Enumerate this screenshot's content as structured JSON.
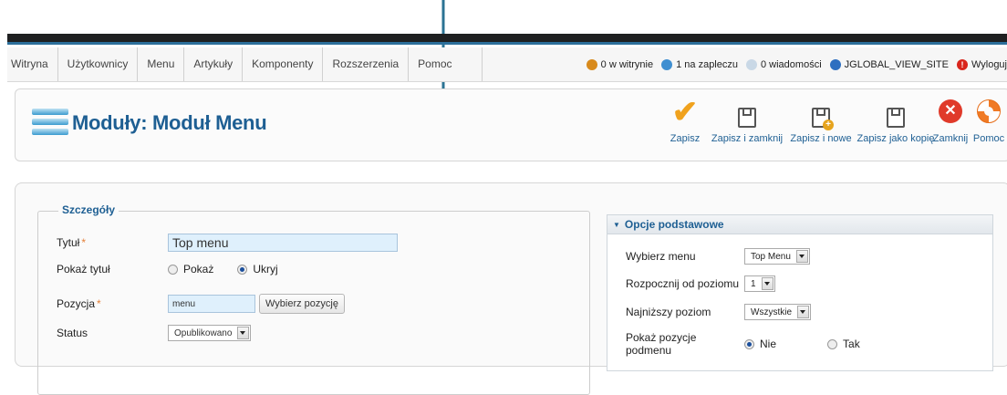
{
  "menubar": {
    "items": [
      "Witryna",
      "Użytkownicy",
      "Menu",
      "Artykuły",
      "Komponenty",
      "Rozszerzenia",
      "Pomoc"
    ],
    "status": {
      "site_users": "0 w witrynie",
      "backend_users": "1 na zapleczu",
      "messages": "0 wiadomości",
      "view_site": "JGLOBAL_VIEW_SITE",
      "logout": "Wyloguj"
    }
  },
  "toolbar": {
    "title": "Moduły: Moduł Menu",
    "buttons": {
      "save": "Zapisz",
      "save_close": "Zapisz i zamknij",
      "save_new": "Zapisz i nowe",
      "save_copy": "Zapisz jako kopię",
      "close": "Zamknij",
      "help": "Pomoc"
    }
  },
  "details": {
    "legend": "Szczegóły",
    "title_label": "Tytuł",
    "title_value": "Top menu",
    "show_title_label": "Pokaż tytuł",
    "show_option": "Pokaż",
    "hide_option": "Ukryj",
    "position_label": "Pozycja",
    "position_value": "menu",
    "choose_position": "Wybierz pozycję",
    "status_label": "Status",
    "status_value": "Opublikowano",
    "required_mark": "*"
  },
  "basic_options": {
    "header": "Opcje podstawowe",
    "menu_label": "Wybierz menu",
    "menu_value": "Top Menu",
    "start_level_label": "Rozpocznij od poziomu",
    "start_level_value": "1",
    "end_level_label": "Najniższy poziom",
    "end_level_value": "Wszystkie",
    "submenu_label": "Pokaż pozycje podmenu",
    "no_option": "Nie",
    "yes_option": "Tak"
  },
  "colors": {
    "accent": "#1e5f93",
    "arrow": "#2b7393"
  }
}
